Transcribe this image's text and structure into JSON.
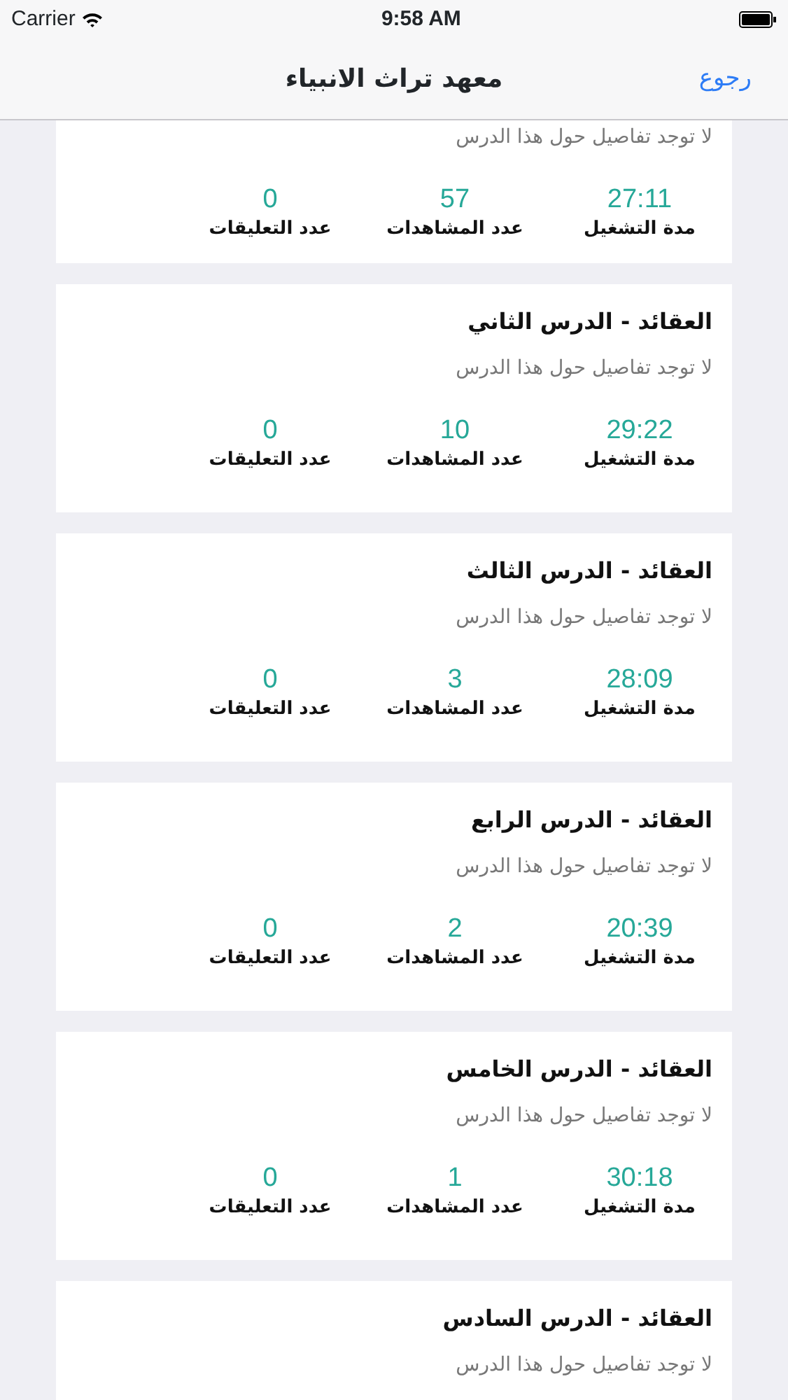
{
  "status_bar": {
    "carrier": "Carrier",
    "time": "9:58 AM"
  },
  "nav": {
    "title": "معهد تراث الانبياء",
    "back": "رجوع"
  },
  "lessons": [
    {
      "description": "لا توجد تفاصيل حول هذا الدرس",
      "duration": "27:11",
      "views": "57",
      "comments": "0",
      "duration_label": "مدة التشغيل",
      "views_label": "عدد المشاهدات",
      "comments_label": "عدد التعليقات"
    },
    {
      "title": "العقائد - الدرس الثاني",
      "description": "لا توجد تفاصيل حول هذا الدرس",
      "duration": "29:22",
      "views": "10",
      "comments": "0",
      "duration_label": "مدة التشغيل",
      "views_label": "عدد المشاهدات",
      "comments_label": "عدد التعليقات"
    },
    {
      "title": "العقائد - الدرس الثالث",
      "description": "لا توجد تفاصيل حول هذا الدرس",
      "duration": "28:09",
      "views": "3",
      "comments": "0",
      "duration_label": "مدة التشغيل",
      "views_label": "عدد المشاهدات",
      "comments_label": "عدد التعليقات"
    },
    {
      "title": "العقائد - الدرس الرابع",
      "description": "لا توجد تفاصيل حول هذا الدرس",
      "duration": "20:39",
      "views": "2",
      "comments": "0",
      "duration_label": "مدة التشغيل",
      "views_label": "عدد المشاهدات",
      "comments_label": "عدد التعليقات"
    },
    {
      "title": "العقائد - الدرس الخامس",
      "description": "لا توجد تفاصيل حول هذا الدرس",
      "duration": "30:18",
      "views": "1",
      "comments": "0",
      "duration_label": "مدة التشغيل",
      "views_label": "عدد المشاهدات",
      "comments_label": "عدد التعليقات"
    },
    {
      "title": "العقائد - الدرس السادس",
      "description": "لا توجد تفاصيل حول هذا الدرس"
    }
  ]
}
